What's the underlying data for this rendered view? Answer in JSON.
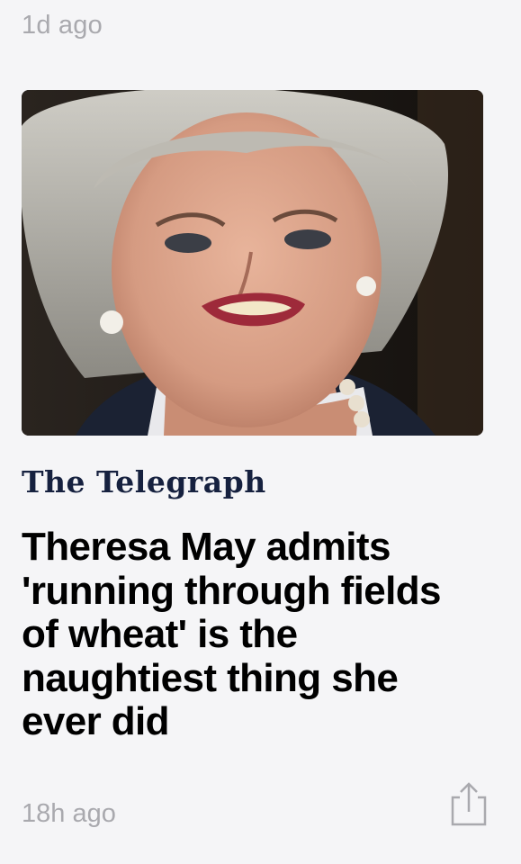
{
  "feed": {
    "previous_item_timestamp": "1d ago"
  },
  "article": {
    "publisher": "The Telegraph",
    "headline": "Theresa May admits 'running through fields of wheat' is the naughtiest thing she ever did",
    "timestamp": "18h ago",
    "image_subject": "photo of a grey-haired woman speaking",
    "share_icon": "share-icon"
  },
  "colors": {
    "background": "#f5f5f7",
    "timestamp": "#a9a9ae",
    "headline": "#000000",
    "publisher": "#16213f",
    "share_icon": "#a9a9ae"
  }
}
